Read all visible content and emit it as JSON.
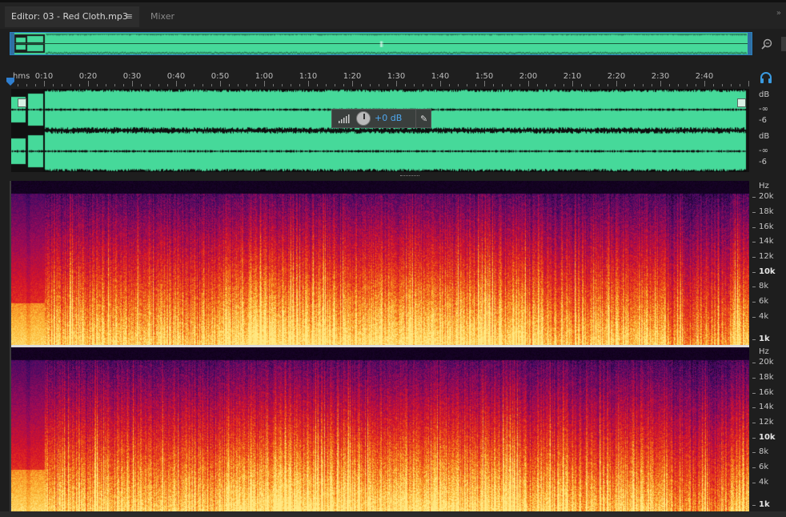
{
  "tabs": [
    {
      "label": "Editor: 03 - Red Cloth.mp3",
      "active": true
    },
    {
      "label": "Mixer",
      "active": false
    }
  ],
  "tab_menu_glyph": "≡",
  "tab_overflow_glyph": "»",
  "ruler": {
    "unit": "hms",
    "labels": [
      "0:10",
      "0:20",
      "0:30",
      "0:40",
      "0:50",
      "1:00",
      "1:10",
      "1:20",
      "1:30",
      "1:40",
      "1:50",
      "2:00",
      "2:10",
      "2:20",
      "2:30",
      "2:40"
    ]
  },
  "hud": {
    "gain": "+0 dB",
    "pin_glyph": "✎"
  },
  "db_scale": {
    "channel_1": [
      "dB",
      "-∞",
      "-6"
    ],
    "channel_2": [
      "dB",
      "-∞",
      "-6"
    ]
  },
  "hz_scale": {
    "unit": "Hz",
    "labels": [
      "20k",
      "18k",
      "16k",
      "14k",
      "12k",
      "10k",
      "8k",
      "6k",
      "4k",
      "1k"
    ],
    "bold": [
      "10k",
      "1k"
    ]
  },
  "icons": {
    "zoom": "zoom-icon",
    "headphones": "headphones-icon",
    "playhead": "playhead-marker-icon",
    "level": "volume-level-icon",
    "pin": "pin-icon"
  },
  "colors": {
    "waveform": "#46d99a",
    "accent": "#2f6fa3",
    "hud_value": "#4fa8f0",
    "spectrum_high": "#ffe080",
    "spectrum_mid": "#d0102a",
    "spectrum_low": "#3a0a5a"
  }
}
